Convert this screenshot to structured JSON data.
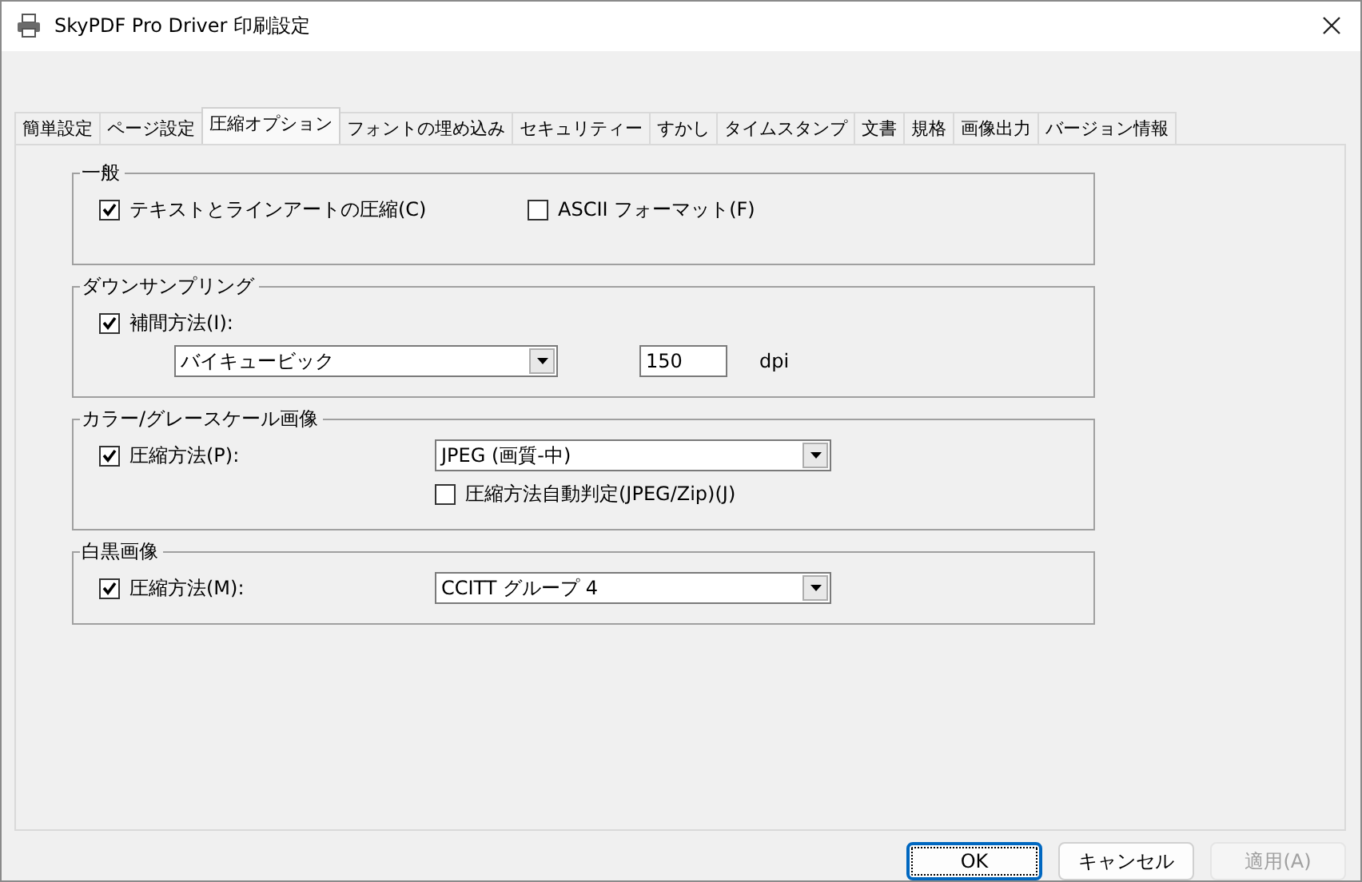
{
  "window": {
    "title": "SkyPDF Pro Driver 印刷設定"
  },
  "tabs": [
    {
      "label": "簡単設定",
      "selected": false
    },
    {
      "label": "ページ設定",
      "selected": false
    },
    {
      "label": "圧縮オプション",
      "selected": true
    },
    {
      "label": "フォントの埋め込み",
      "selected": false
    },
    {
      "label": "セキュリティー",
      "selected": false
    },
    {
      "label": "すかし",
      "selected": false
    },
    {
      "label": "タイムスタンプ",
      "selected": false
    },
    {
      "label": "文書",
      "selected": false
    },
    {
      "label": "規格",
      "selected": false
    },
    {
      "label": "画像出力",
      "selected": false
    },
    {
      "label": "バージョン情報",
      "selected": false
    }
  ],
  "groups": [
    {
      "title": "一般",
      "rows": [
        [
          {
            "kind": "checkbox",
            "label": "テキストとラインアートの圧縮(C)",
            "checked": true
          },
          {
            "kind": "checkbox",
            "label": "ASCII フォーマット(F)",
            "checked": false
          }
        ]
      ]
    },
    {
      "title": "ダウンサンプリング",
      "rows": [
        [
          {
            "kind": "checkbox",
            "label": "補間方法(I):",
            "checked": true
          }
        ],
        [
          {
            "kind": "select",
            "value": "バイキュービック"
          },
          {
            "kind": "input",
            "value": "150"
          },
          {
            "kind": "text",
            "label": "dpi"
          }
        ]
      ]
    },
    {
      "title": "カラー/グレースケール画像",
      "rows": [
        [
          {
            "kind": "checkbox",
            "label": "圧縮方法(P):",
            "checked": true
          },
          {
            "kind": "select",
            "value": "JPEG (画質-中)"
          }
        ],
        [
          "",
          {
            "kind": "checkbox",
            "label": "圧縮方法自動判定(JPEG/Zip)(J)",
            "checked": false
          }
        ]
      ]
    },
    {
      "title": "白黒画像",
      "rows": [
        [
          {
            "kind": "checkbox",
            "label": "圧縮方法(M):",
            "checked": true
          },
          {
            "kind": "select",
            "value": "CCITT グループ 4"
          }
        ]
      ]
    }
  ],
  "buttons": [
    {
      "label": "OK",
      "disabled": false,
      "default": true
    },
    {
      "label": "キャンセル",
      "disabled": false,
      "default": false
    },
    {
      "label": "適用(A)",
      "disabled": true,
      "default": false
    }
  ]
}
